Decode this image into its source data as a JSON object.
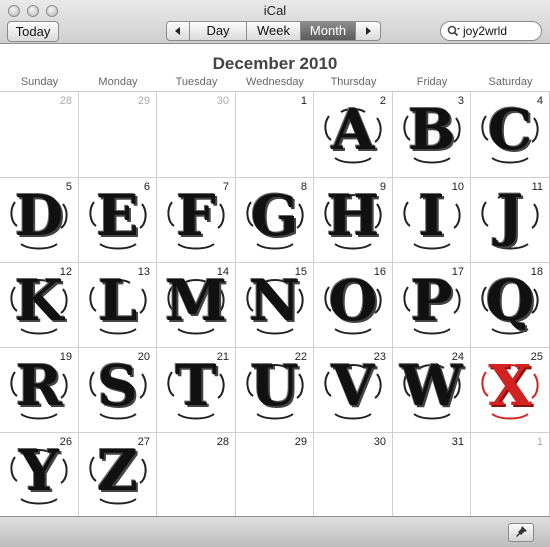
{
  "window": {
    "title": "iCal"
  },
  "toolbar": {
    "today_label": "Today",
    "prev_icon": "triangle-left-icon",
    "next_icon": "triangle-right-icon",
    "views": [
      {
        "label": "Day",
        "active": false
      },
      {
        "label": "Week",
        "active": false
      },
      {
        "label": "Month",
        "active": true
      }
    ]
  },
  "search": {
    "value": "joy2wrld",
    "icon": "magnifier-icon"
  },
  "calendar": {
    "month_title": "December 2010",
    "weekdays": [
      "Sunday",
      "Monday",
      "Tuesday",
      "Wednesday",
      "Thursday",
      "Friday",
      "Saturday"
    ],
    "weeks": [
      [
        {
          "day": "28",
          "dim": true,
          "letter": ""
        },
        {
          "day": "29",
          "dim": true,
          "letter": ""
        },
        {
          "day": "30",
          "dim": true,
          "letter": ""
        },
        {
          "day": "1",
          "dim": false,
          "letter": ""
        },
        {
          "day": "2",
          "dim": false,
          "letter": "A"
        },
        {
          "day": "3",
          "dim": false,
          "letter": "B"
        },
        {
          "day": "4",
          "dim": false,
          "letter": "C"
        }
      ],
      [
        {
          "day": "5",
          "dim": false,
          "letter": "D"
        },
        {
          "day": "6",
          "dim": false,
          "letter": "E"
        },
        {
          "day": "7",
          "dim": false,
          "letter": "F"
        },
        {
          "day": "8",
          "dim": false,
          "letter": "G"
        },
        {
          "day": "9",
          "dim": false,
          "letter": "H"
        },
        {
          "day": "10",
          "dim": false,
          "letter": "I"
        },
        {
          "day": "11",
          "dim": false,
          "letter": "J"
        }
      ],
      [
        {
          "day": "12",
          "dim": false,
          "letter": "K"
        },
        {
          "day": "13",
          "dim": false,
          "letter": "L"
        },
        {
          "day": "14",
          "dim": false,
          "letter": "M"
        },
        {
          "day": "15",
          "dim": false,
          "letter": "N"
        },
        {
          "day": "16",
          "dim": false,
          "letter": "O"
        },
        {
          "day": "17",
          "dim": false,
          "letter": "P"
        },
        {
          "day": "18",
          "dim": false,
          "letter": "Q"
        }
      ],
      [
        {
          "day": "19",
          "dim": false,
          "letter": "R"
        },
        {
          "day": "20",
          "dim": false,
          "letter": "S"
        },
        {
          "day": "21",
          "dim": false,
          "letter": "T"
        },
        {
          "day": "22",
          "dim": false,
          "letter": "U"
        },
        {
          "day": "23",
          "dim": false,
          "letter": "V"
        },
        {
          "day": "24",
          "dim": false,
          "letter": "W"
        },
        {
          "day": "25",
          "dim": false,
          "letter": "X",
          "highlight": true
        }
      ],
      [
        {
          "day": "26",
          "dim": false,
          "letter": "Y"
        },
        {
          "day": "27",
          "dim": false,
          "letter": "Z"
        },
        {
          "day": "28",
          "dim": false,
          "letter": ""
        },
        {
          "day": "29",
          "dim": false,
          "letter": ""
        },
        {
          "day": "30",
          "dim": false,
          "letter": ""
        },
        {
          "day": "31",
          "dim": false,
          "letter": ""
        },
        {
          "day": "1",
          "dim": true,
          "letter": ""
        }
      ]
    ]
  },
  "colors": {
    "highlight_letter": "#d32222",
    "letter": "#111111",
    "active_segment": "#6f6f6f"
  },
  "bottombar": {
    "pin_icon": "pushpin-icon"
  }
}
